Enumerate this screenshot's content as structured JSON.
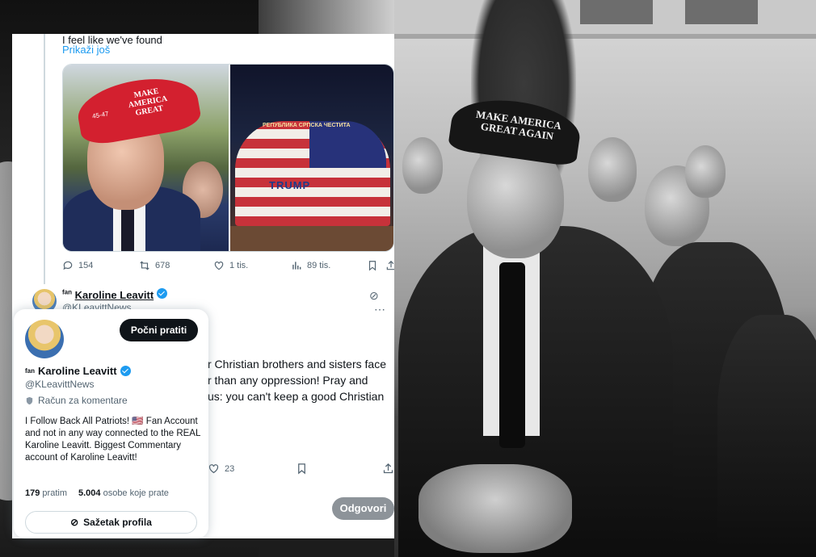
{
  "tweet": {
    "text_top": "I feel like we've found",
    "show_more": "Prikaži još",
    "media": {
      "left_cap_text": "MAKE AMERICA GREAT",
      "left_cap_side": "45-47",
      "right_banner": "РЕПУБЛИКА СРПСКА ЧЕСТИТА",
      "right_sign": "TRUMP"
    },
    "actions": {
      "replies": "154",
      "retweets": "678",
      "likes": "1 tis.",
      "views": "89 tis."
    }
  },
  "second_tweet": {
    "name_prefix": "fan",
    "name": "Karoline Leavitt",
    "handle": "@KLeavittNews",
    "body_line1": "r Christian brothers and sisters face",
    "body_line2": "r than any oppression! Pray and",
    "body_line3": "us: you can't keep a good Christian",
    "likes": "23",
    "reply_button": "Odgovori"
  },
  "hover_card": {
    "follow_button": "Počni pratiti",
    "name_prefix": "fan",
    "name": "Karoline Leavitt",
    "handle": "@KLeavittNews",
    "account_label": "Račun za komentare",
    "bio": "I Follow Back All Patriots! 🇺🇸 Fan Account and not in any way connected to the REAL Karoline Leavitt. Biggest Commentary account of Karoline Leavitt!",
    "following_count": "179",
    "following_label": "pratim",
    "followers_count": "5.004",
    "followers_label": "osobe koje prate",
    "summary_button": "Sažetak profila"
  },
  "background": {
    "cap_text": "MAKE AMERICA GREAT AGAIN"
  },
  "colors": {
    "accent": "#1d9bf0",
    "text": "#0f1419",
    "muted": "#536471",
    "follow_bg": "#0f1419"
  }
}
